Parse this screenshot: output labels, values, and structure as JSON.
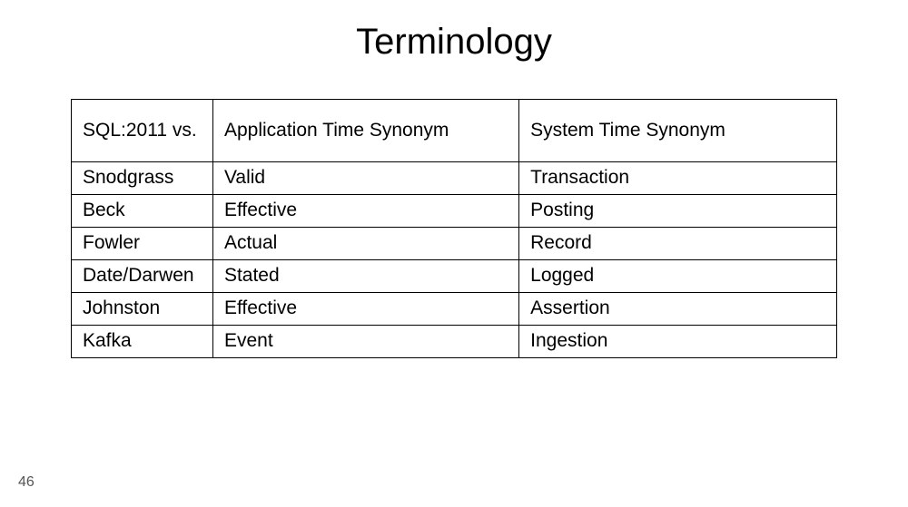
{
  "title": "Terminology",
  "page_number": "46",
  "table": {
    "headers": [
      "SQL:2011 vs.",
      "Application Time Synonym",
      "System Time Synonym"
    ],
    "rows": [
      [
        "Snodgrass",
        "Valid",
        "Transaction"
      ],
      [
        "Beck",
        "Effective",
        "Posting"
      ],
      [
        "Fowler",
        "Actual",
        "Record"
      ],
      [
        "Date/Darwen",
        "Stated",
        "Logged"
      ],
      [
        "Johnston",
        "Effective",
        "Assertion"
      ],
      [
        "Kafka",
        "Event",
        "Ingestion"
      ]
    ]
  }
}
